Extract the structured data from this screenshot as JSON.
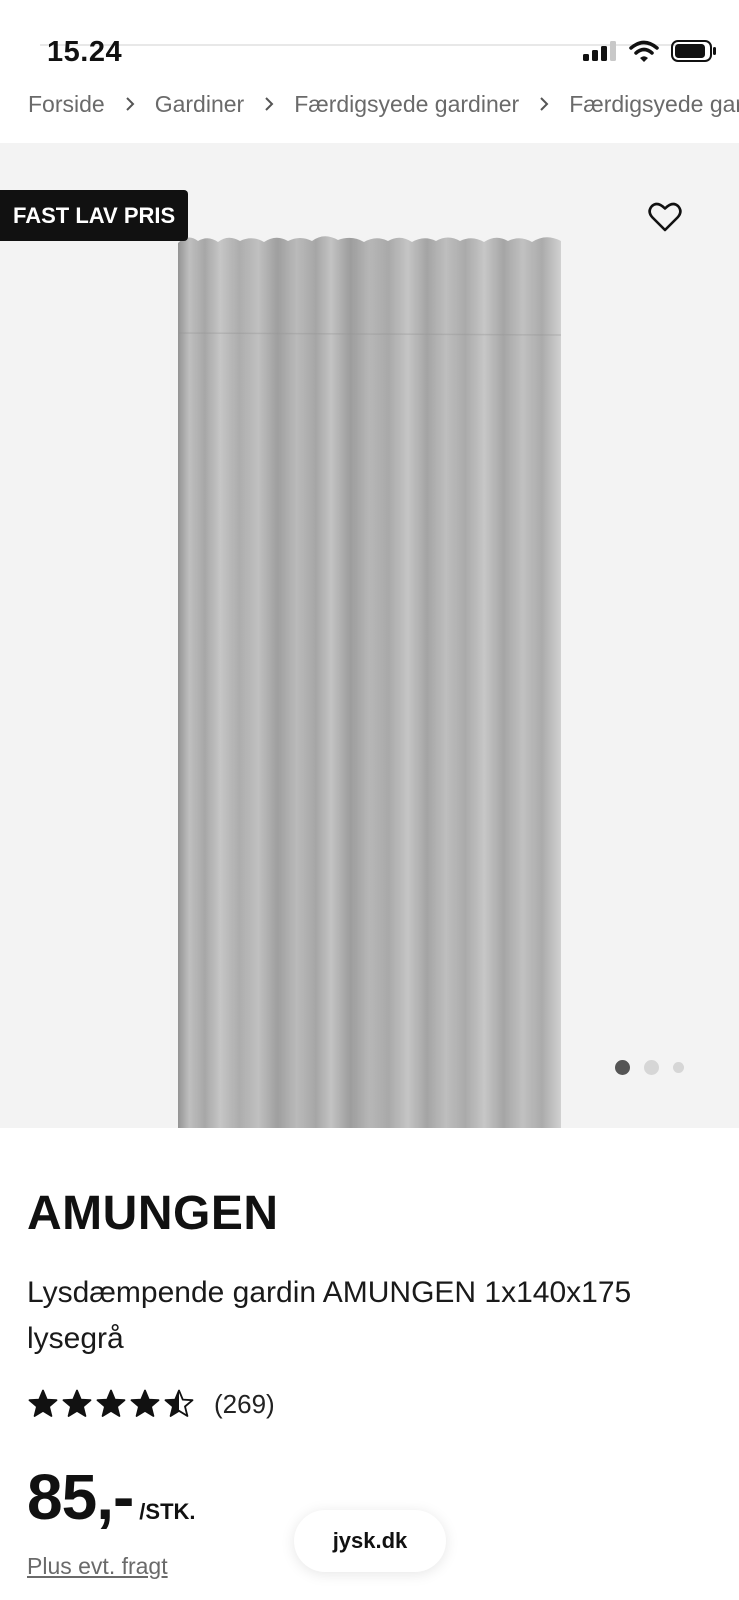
{
  "status_bar": {
    "time": "15.24",
    "icons": [
      "cellular-signal-icon",
      "wifi-icon",
      "battery-icon"
    ]
  },
  "breadcrumb": {
    "items": [
      "Forside",
      "Gardiner",
      "Færdigsyede gardiner",
      "Færdigsyede gardiner"
    ],
    "separator_icon": "chevron-right-icon"
  },
  "gallery": {
    "badge": "FAST LAV PRIS",
    "favorite_icon": "heart-outline-icon",
    "image_total": 3,
    "image_active": 1
  },
  "product": {
    "brand": "AMUNGEN",
    "description": "Lysdæmpende gardin AMUNGEN 1x140x175 lysegrå",
    "rating": {
      "value": 4.5,
      "max": 5,
      "count": "(269)"
    },
    "price": "85,-",
    "unit": "/STK.",
    "shipping_note": "Plus evt. fragt"
  },
  "browser": {
    "url": "jysk.dk"
  },
  "colors": {
    "text": "#111111",
    "muted": "#6a6a6a",
    "gallery_bg": "#f3f3f3",
    "badge_bg": "#111111",
    "badge_text": "#ffffff",
    "dot_active": "#555555",
    "dot_inactive": "#d6d6d6"
  }
}
